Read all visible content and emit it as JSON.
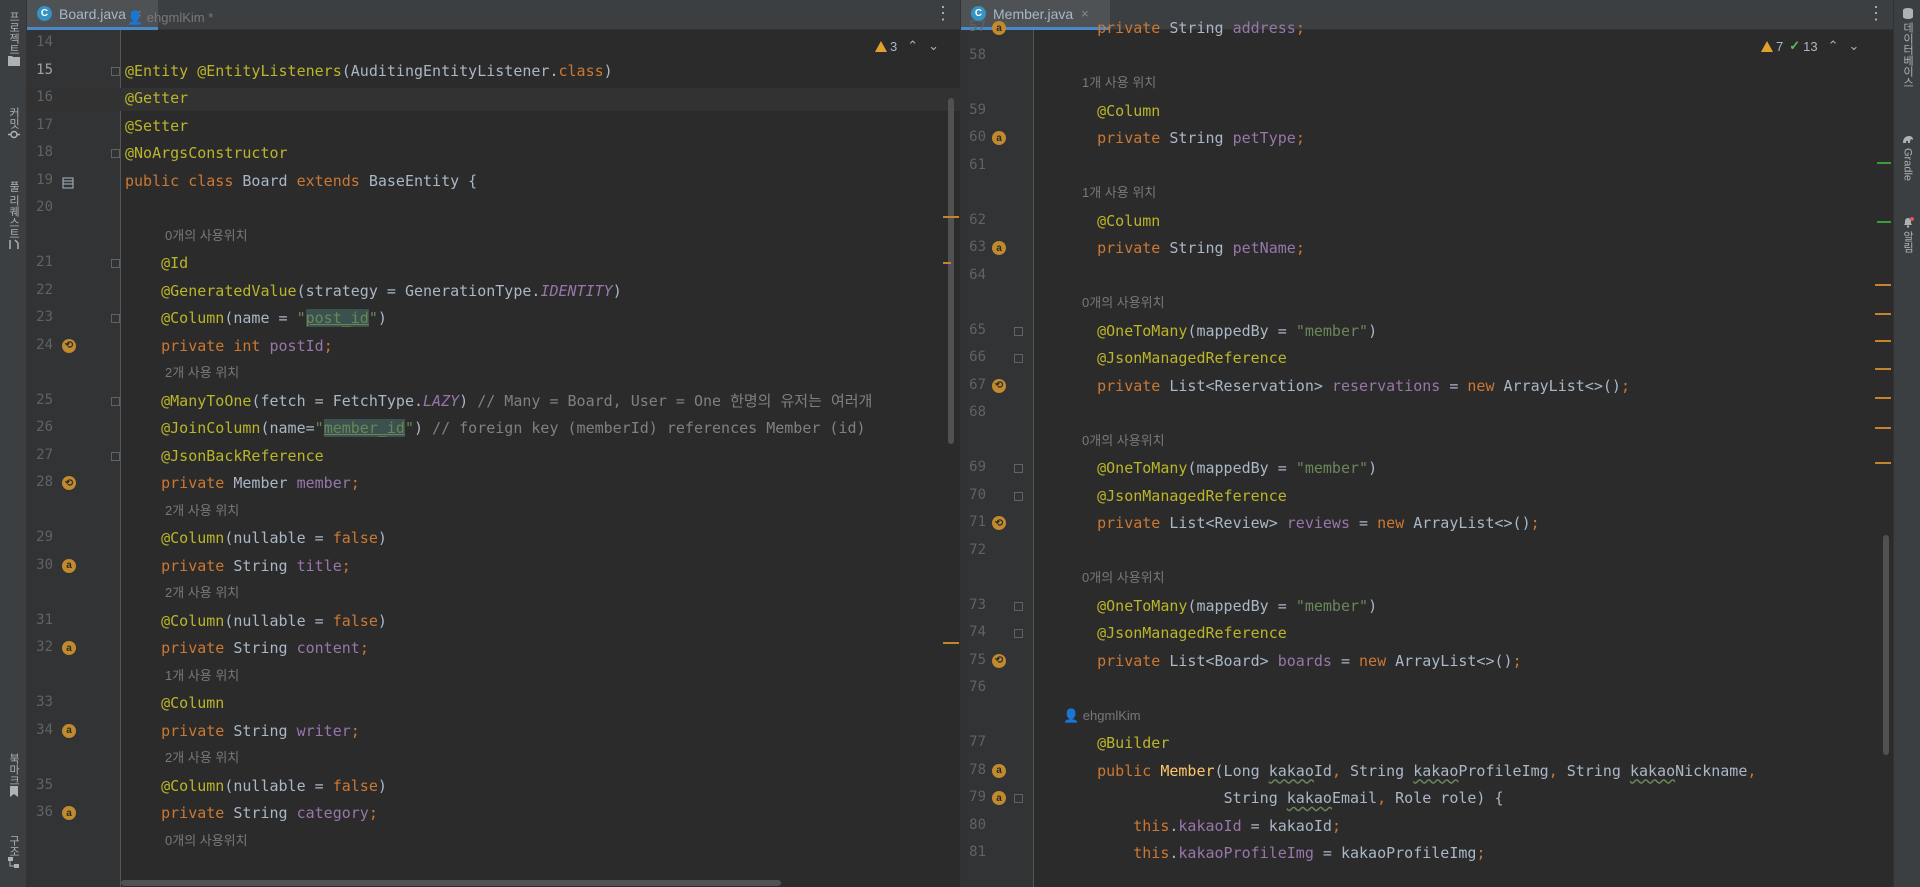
{
  "left_toolwindows": [
    "프로젝트",
    "커밋",
    "풀 리퀘스트",
    "북마크",
    "구조"
  ],
  "right_toolwindows": [
    "데이터베이스",
    "Gradle",
    "알림"
  ],
  "left_editor": {
    "tab": {
      "title": "Board.java",
      "icon": "java-class-icon",
      "close": "×"
    },
    "inspection": {
      "warnings": "3"
    },
    "author_hint": "ehgmlKim *",
    "rows": [
      {
        "type": "code",
        "line": "14",
        "tokens": []
      },
      {
        "type": "code",
        "line": "15",
        "current": true,
        "tokens": [
          [
            "@Entity",
            "ann"
          ],
          [
            " ",
            "plain"
          ],
          [
            "@EntityListeners",
            "ann"
          ],
          [
            "(AuditingEntityListener.",
            "plain"
          ],
          [
            "class",
            "kw"
          ],
          [
            ")",
            "plain"
          ]
        ]
      },
      {
        "type": "code",
        "line": "16",
        "tokens": [
          [
            "@Getter",
            "ann"
          ]
        ]
      },
      {
        "type": "code",
        "line": "17",
        "tokens": [
          [
            "@Setter",
            "ann"
          ]
        ]
      },
      {
        "type": "code",
        "line": "18",
        "tokens": [
          [
            "@NoArgsConstructor",
            "ann"
          ]
        ]
      },
      {
        "type": "code",
        "line": "19",
        "tokens": [
          [
            "public class ",
            "kw"
          ],
          [
            "Board ",
            "plain"
          ],
          [
            "extends ",
            "kw"
          ],
          [
            "BaseEntity {",
            "plain"
          ]
        ]
      },
      {
        "type": "code",
        "line": "20",
        "tokens": []
      },
      {
        "type": "hint",
        "text": "0개의 사용위치"
      },
      {
        "type": "code",
        "line": "21",
        "tokens": [
          [
            "    ",
            "plain"
          ],
          [
            "@Id",
            "ann"
          ]
        ]
      },
      {
        "type": "code",
        "line": "22",
        "tokens": [
          [
            "    ",
            "plain"
          ],
          [
            "@GeneratedValue",
            "ann"
          ],
          [
            "(strategy = GenerationType.",
            "plain"
          ],
          [
            "IDENTITY",
            "italic"
          ],
          [
            ")",
            "plain"
          ]
        ]
      },
      {
        "type": "code",
        "line": "23",
        "tokens": [
          [
            "    ",
            "plain"
          ],
          [
            "@Column",
            "ann"
          ],
          [
            "(name = ",
            "plain"
          ],
          [
            "\"",
            "str"
          ],
          [
            "post_id",
            "strhl"
          ],
          [
            "\"",
            "str"
          ],
          [
            ")",
            "plain"
          ]
        ]
      },
      {
        "type": "code",
        "line": "24",
        "tokens": [
          [
            "    ",
            "plain"
          ],
          [
            "private int ",
            "kw"
          ],
          [
            "postId",
            "field"
          ],
          [
            ";",
            "kw"
          ]
        ]
      },
      {
        "type": "hint",
        "text": "2개 사용 위치"
      },
      {
        "type": "code",
        "line": "25",
        "tokens": [
          [
            "    ",
            "plain"
          ],
          [
            "@ManyToOne",
            "ann"
          ],
          [
            "(fetch = FetchType.",
            "plain"
          ],
          [
            "LAZY",
            "italic"
          ],
          [
            ") ",
            "plain"
          ],
          [
            "// Many = Board, User = One 한명의 유저는 여러개",
            "comment"
          ]
        ]
      },
      {
        "type": "code",
        "line": "26",
        "tokens": [
          [
            "    ",
            "plain"
          ],
          [
            "@JoinColumn",
            "ann"
          ],
          [
            "(name=",
            "plain"
          ],
          [
            "\"",
            "str"
          ],
          [
            "member_id",
            "strhl"
          ],
          [
            "\"",
            "str"
          ],
          [
            ") ",
            "plain"
          ],
          [
            "// foreign key (memberId) references Member (id)",
            "comment"
          ]
        ]
      },
      {
        "type": "code",
        "line": "27",
        "tokens": [
          [
            "    ",
            "plain"
          ],
          [
            "@JsonBackReference",
            "ann"
          ]
        ]
      },
      {
        "type": "code",
        "line": "28",
        "tokens": [
          [
            "    ",
            "plain"
          ],
          [
            "private ",
            "kw"
          ],
          [
            "Member ",
            "plain"
          ],
          [
            "member",
            "field"
          ],
          [
            ";",
            "kw"
          ]
        ]
      },
      {
        "type": "hint",
        "text": "2개 사용 위치"
      },
      {
        "type": "code",
        "line": "29",
        "tokens": [
          [
            "    ",
            "plain"
          ],
          [
            "@Column",
            "ann"
          ],
          [
            "(nullable = ",
            "plain"
          ],
          [
            "false",
            "kw"
          ],
          [
            ")",
            "plain"
          ]
        ]
      },
      {
        "type": "code",
        "line": "30",
        "tokens": [
          [
            "    ",
            "plain"
          ],
          [
            "private ",
            "kw"
          ],
          [
            "String ",
            "plain"
          ],
          [
            "title",
            "field"
          ],
          [
            ";",
            "kw"
          ]
        ]
      },
      {
        "type": "hint",
        "text": "2개 사용 위치"
      },
      {
        "type": "code",
        "line": "31",
        "tokens": [
          [
            "    ",
            "plain"
          ],
          [
            "@Column",
            "ann"
          ],
          [
            "(nullable = ",
            "plain"
          ],
          [
            "false",
            "kw"
          ],
          [
            ")",
            "plain"
          ]
        ]
      },
      {
        "type": "code",
        "line": "32",
        "tokens": [
          [
            "    ",
            "plain"
          ],
          [
            "private ",
            "kw"
          ],
          [
            "String ",
            "plain"
          ],
          [
            "content",
            "field"
          ],
          [
            ";",
            "kw"
          ]
        ]
      },
      {
        "type": "hint",
        "text": "1개 사용 위치"
      },
      {
        "type": "code",
        "line": "33",
        "tokens": [
          [
            "    ",
            "plain"
          ],
          [
            "@Column",
            "ann"
          ]
        ]
      },
      {
        "type": "code",
        "line": "34",
        "tokens": [
          [
            "    ",
            "plain"
          ],
          [
            "private ",
            "kw"
          ],
          [
            "String ",
            "plain"
          ],
          [
            "writer",
            "field"
          ],
          [
            ";",
            "kw"
          ]
        ]
      },
      {
        "type": "hint",
        "text": "2개 사용 위치"
      },
      {
        "type": "code",
        "line": "35",
        "tokens": [
          [
            "    ",
            "plain"
          ],
          [
            "@Column",
            "ann"
          ],
          [
            "(nullable = ",
            "plain"
          ],
          [
            "false",
            "kw"
          ],
          [
            ")",
            "plain"
          ]
        ]
      },
      {
        "type": "code",
        "line": "36",
        "tokens": [
          [
            "    ",
            "plain"
          ],
          [
            "private ",
            "kw"
          ],
          [
            "String ",
            "plain"
          ],
          [
            "category",
            "field"
          ],
          [
            ";",
            "kw"
          ]
        ]
      },
      {
        "type": "hint",
        "text": "0개의 사용위치"
      }
    ]
  },
  "right_editor": {
    "tab": {
      "title": "Member.java",
      "icon": "java-class-icon",
      "close": "×"
    },
    "inspection": {
      "warnings": "7",
      "weak_warnings": "13"
    },
    "rows": [
      {
        "type": "code",
        "line": "57",
        "tokens": [
          [
            "    ",
            "plain"
          ],
          [
            "private ",
            "kw"
          ],
          [
            "String ",
            "plain"
          ],
          [
            "address",
            "field"
          ],
          [
            ";",
            "kw"
          ]
        ]
      },
      {
        "type": "code",
        "line": "58",
        "tokens": []
      },
      {
        "type": "hint",
        "text": "1개 사용 위치"
      },
      {
        "type": "code",
        "line": "59",
        "tokens": [
          [
            "    ",
            "plain"
          ],
          [
            "@Column",
            "ann"
          ]
        ]
      },
      {
        "type": "code",
        "line": "60",
        "tokens": [
          [
            "    ",
            "plain"
          ],
          [
            "private ",
            "kw"
          ],
          [
            "String ",
            "plain"
          ],
          [
            "petType",
            "field"
          ],
          [
            ";",
            "kw"
          ]
        ]
      },
      {
        "type": "code",
        "line": "61",
        "tokens": []
      },
      {
        "type": "hint",
        "text": "1개 사용 위치"
      },
      {
        "type": "code",
        "line": "62",
        "tokens": [
          [
            "    ",
            "plain"
          ],
          [
            "@Column",
            "ann"
          ]
        ]
      },
      {
        "type": "code",
        "line": "63",
        "tokens": [
          [
            "    ",
            "plain"
          ],
          [
            "private ",
            "kw"
          ],
          [
            "String ",
            "plain"
          ],
          [
            "petName",
            "field"
          ],
          [
            ";",
            "kw"
          ]
        ]
      },
      {
        "type": "code",
        "line": "64",
        "tokens": []
      },
      {
        "type": "hint",
        "text": "0개의 사용위치"
      },
      {
        "type": "code",
        "line": "65",
        "tokens": [
          [
            "    ",
            "plain"
          ],
          [
            "@OneToMany",
            "ann"
          ],
          [
            "(mappedBy = ",
            "plain"
          ],
          [
            "\"member\"",
            "str"
          ],
          [
            ")",
            "plain"
          ]
        ]
      },
      {
        "type": "code",
        "line": "66",
        "tokens": [
          [
            "    ",
            "plain"
          ],
          [
            "@JsonManagedReference",
            "ann"
          ]
        ]
      },
      {
        "type": "code",
        "line": "67",
        "tokens": [
          [
            "    ",
            "plain"
          ],
          [
            "private ",
            "kw"
          ],
          [
            "List<Reservation> ",
            "plain"
          ],
          [
            "reservations",
            "field"
          ],
          [
            " = ",
            "plain"
          ],
          [
            "new ",
            "kw"
          ],
          [
            "ArrayList<>()",
            "plain"
          ],
          [
            ";",
            "kw"
          ]
        ]
      },
      {
        "type": "code",
        "line": "68",
        "tokens": []
      },
      {
        "type": "hint",
        "text": "0개의 사용위치"
      },
      {
        "type": "code",
        "line": "69",
        "tokens": [
          [
            "    ",
            "plain"
          ],
          [
            "@OneToMany",
            "ann"
          ],
          [
            "(mappedBy = ",
            "plain"
          ],
          [
            "\"member\"",
            "str"
          ],
          [
            ")",
            "plain"
          ]
        ]
      },
      {
        "type": "code",
        "line": "70",
        "tokens": [
          [
            "    ",
            "plain"
          ],
          [
            "@JsonManagedReference",
            "ann"
          ]
        ]
      },
      {
        "type": "code",
        "line": "71",
        "tokens": [
          [
            "    ",
            "plain"
          ],
          [
            "private ",
            "kw"
          ],
          [
            "List<Review> ",
            "plain"
          ],
          [
            "reviews",
            "field"
          ],
          [
            " = ",
            "plain"
          ],
          [
            "new ",
            "kw"
          ],
          [
            "ArrayList<>()",
            "plain"
          ],
          [
            ";",
            "kw"
          ]
        ]
      },
      {
        "type": "code",
        "line": "72",
        "tokens": []
      },
      {
        "type": "hint",
        "text": "0개의 사용위치"
      },
      {
        "type": "code",
        "line": "73",
        "tokens": [
          [
            "    ",
            "plain"
          ],
          [
            "@OneToMany",
            "ann"
          ],
          [
            "(mappedBy = ",
            "plain"
          ],
          [
            "\"member\"",
            "str"
          ],
          [
            ")",
            "plain"
          ]
        ]
      },
      {
        "type": "code",
        "line": "74",
        "tokens": [
          [
            "    ",
            "plain"
          ],
          [
            "@JsonManagedReference",
            "ann"
          ]
        ]
      },
      {
        "type": "code",
        "line": "75",
        "tokens": [
          [
            "    ",
            "plain"
          ],
          [
            "private ",
            "kw"
          ],
          [
            "List<Board> ",
            "plain"
          ],
          [
            "boards",
            "field"
          ],
          [
            " = ",
            "plain"
          ],
          [
            "new ",
            "kw"
          ],
          [
            "ArrayList<>()",
            "plain"
          ],
          [
            ";",
            "kw"
          ]
        ]
      },
      {
        "type": "code",
        "line": "76",
        "tokens": []
      },
      {
        "type": "author",
        "text": "ehgmlKim"
      },
      {
        "type": "code",
        "line": "77",
        "tokens": [
          [
            "    ",
            "plain"
          ],
          [
            "@Builder",
            "ann"
          ]
        ]
      },
      {
        "type": "code",
        "line": "78",
        "tokens": [
          [
            "    ",
            "plain"
          ],
          [
            "public ",
            "kw"
          ],
          [
            "Member",
            "method"
          ],
          [
            "(Long ",
            "plain"
          ],
          [
            "kakao",
            "wavy"
          ],
          [
            "Id",
            "plain"
          ],
          [
            ", ",
            "kw"
          ],
          [
            "String ",
            "plain"
          ],
          [
            "kakao",
            "wavy"
          ],
          [
            "ProfileImg",
            "plain"
          ],
          [
            ", ",
            "kw"
          ],
          [
            "String ",
            "plain"
          ],
          [
            "kakao",
            "wavy"
          ],
          [
            "Nickname",
            "plain"
          ],
          [
            ",",
            "kw"
          ]
        ]
      },
      {
        "type": "code",
        "line": "79",
        "tokens": [
          [
            "                  ",
            "plain"
          ],
          [
            "String ",
            "plain"
          ],
          [
            "kakao",
            "wavy"
          ],
          [
            "Email",
            "plain"
          ],
          [
            ", ",
            "kw"
          ],
          [
            "Role role) {",
            "plain"
          ]
        ]
      },
      {
        "type": "code",
        "line": "80",
        "tokens": [
          [
            "        ",
            "plain"
          ],
          [
            "this",
            "kw"
          ],
          [
            ".",
            "plain"
          ],
          [
            "kakaoId",
            "field"
          ],
          [
            " = kakaoId",
            "plain"
          ],
          [
            ";",
            "kw"
          ]
        ]
      },
      {
        "type": "code",
        "line": "81",
        "tokens": [
          [
            "        ",
            "plain"
          ],
          [
            "this",
            "kw"
          ],
          [
            ".",
            "plain"
          ],
          [
            "kakaoProfileImg",
            "field"
          ],
          [
            " = kakaoProfileImg",
            "plain"
          ],
          [
            ";",
            "kw"
          ]
        ]
      }
    ]
  }
}
